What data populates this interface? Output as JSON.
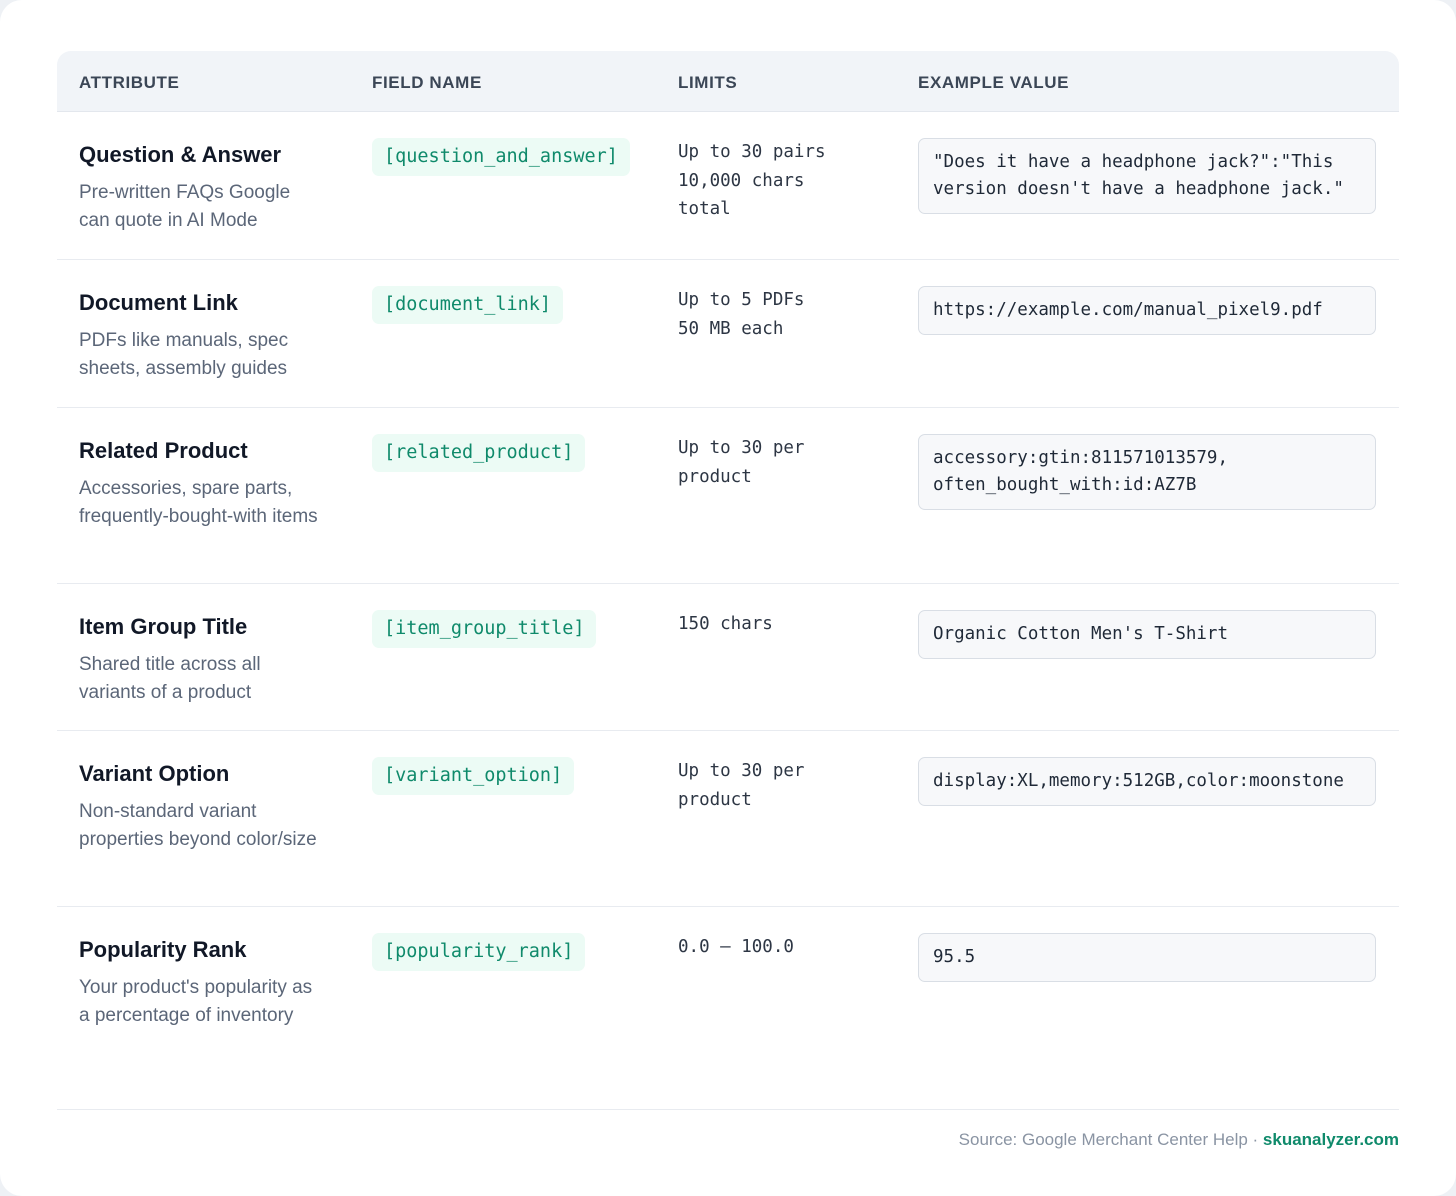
{
  "table": {
    "headers": {
      "attribute": "ATTRIBUTE",
      "field_name": "FIELD NAME",
      "limits": "LIMITS",
      "example_value": "EXAMPLE VALUE"
    },
    "rows": [
      {
        "title": "Question & Answer",
        "description": "Pre-written FAQs Google can quote in AI Mode",
        "field": "[question_and_answer]",
        "limits": "Up to 30 pairs\n10,000 chars\ntotal",
        "example": "\"Does it have a headphone jack?\":\"This version doesn't have a headphone jack.\""
      },
      {
        "title": "Document Link",
        "description": "PDFs like manuals, spec sheets, assembly guides",
        "field": "[document_link]",
        "limits": "Up to 5 PDFs\n50 MB each",
        "example": "https://example.com/manual_pixel9.pdf"
      },
      {
        "title": "Related Product",
        "description": "Accessories, spare parts, frequently-bought-with items",
        "field": "[related_product]",
        "limits": "Up to 30 per\nproduct",
        "example": "accessory:gtin:811571013579,\noften_bought_with:id:AZ7B"
      },
      {
        "title": "Item Group Title",
        "description": "Shared title across all variants of a product",
        "field": "[item_group_title]",
        "limits": "150 chars",
        "example": "Organic Cotton Men's T-Shirt"
      },
      {
        "title": "Variant Option",
        "description": "Non-standard variant properties beyond color/size",
        "field": "[variant_option]",
        "limits": "Up to 30 per\nproduct",
        "example": "display:XL,memory:512GB,color:moonstone"
      },
      {
        "title": "Popularity Rank",
        "description": "Your product's popularity as a percentage of inventory",
        "field": "[popularity_rank]",
        "limits": "0.0 – 100.0",
        "example": "95.5"
      }
    ]
  },
  "footer": {
    "source": "Source: Google Merchant Center Help · ",
    "brand": "skuanalyzer.com"
  }
}
